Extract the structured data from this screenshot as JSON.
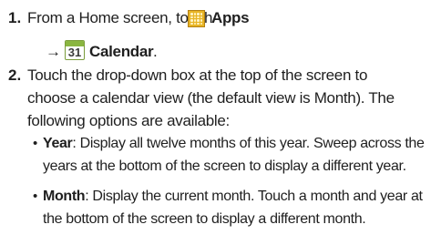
{
  "steps": [
    {
      "number": "1.",
      "line1_prefix": "From a Home screen, touch",
      "apps_label": "Apps",
      "arrow": "→",
      "calendar_icon_day": "31",
      "calendar_label": "Calendar",
      "period": "."
    },
    {
      "number": "2.",
      "lines": [
        "Touch the drop-down box at the top of the screen to",
        "choose a calendar view (the default view is Month). The",
        "following options are available:"
      ]
    }
  ],
  "options": [
    {
      "term": "Year",
      "lines": [
        ": Display all twelve months of this year. Sweep across the",
        "years at the bottom of the screen to display a different year."
      ]
    },
    {
      "term": "Month",
      "lines": [
        ": Display the current month. Touch a month and year at",
        "the bottom of the screen to display a different month."
      ]
    }
  ],
  "bullet_char": "•",
  "icons": {
    "apps": "apps-grid-icon",
    "calendar": "calendar-icon"
  },
  "colors": {
    "text": "#1f1f1f",
    "apps_icon": "#e8b526",
    "calendar_icon": "#8ab640"
  }
}
